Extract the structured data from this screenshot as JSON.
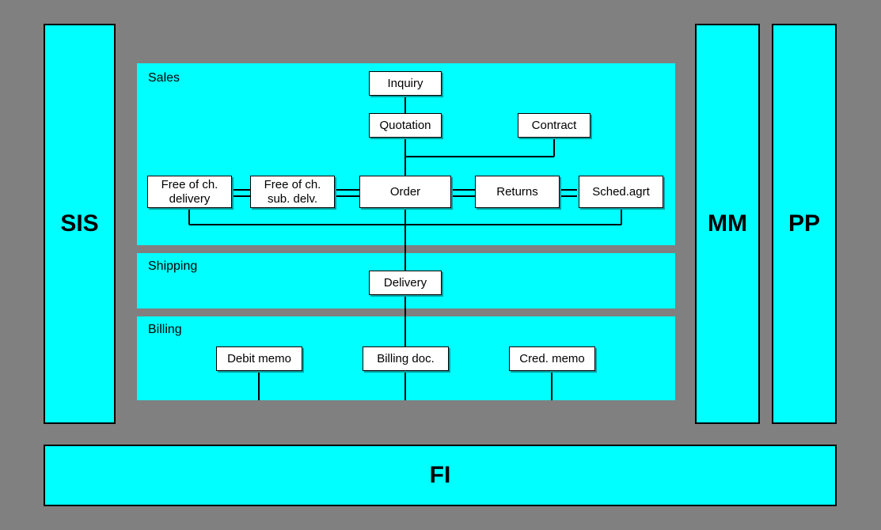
{
  "modules": {
    "sis": "SIS",
    "mm": "MM",
    "pp": "PP",
    "fi": "FI"
  },
  "sections": {
    "sales": "Sales",
    "shipping": "Shipping",
    "billing": "Billing"
  },
  "nodes": {
    "inquiry": "Inquiry",
    "quotation": "Quotation",
    "contract": "Contract",
    "free_delivery": "Free of ch. delivery",
    "free_sub": "Free of ch. sub. delv.",
    "order": "Order",
    "returns": "Returns",
    "sched_agrt": "Sched.agrt",
    "delivery": "Delivery",
    "debit_memo": "Debit memo",
    "billing_doc": "Billing doc.",
    "cred_memo": "Cred. memo"
  }
}
